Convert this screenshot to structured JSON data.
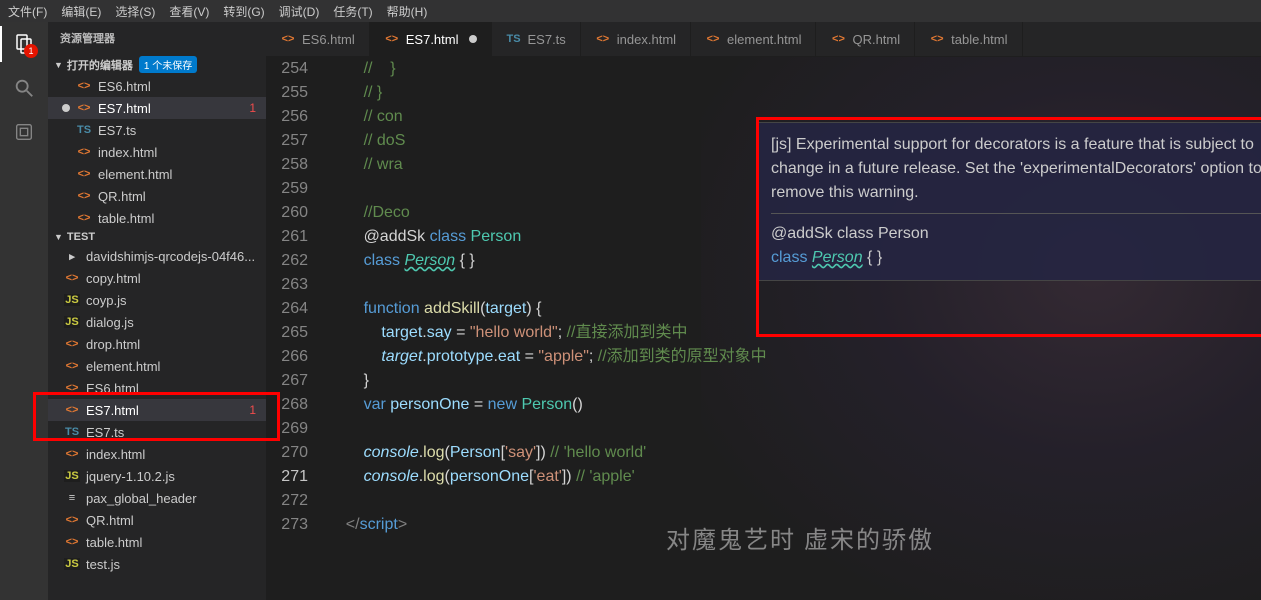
{
  "menu": [
    "文件(F)",
    "编辑(E)",
    "选择(S)",
    "查看(V)",
    "转到(G)",
    "调试(D)",
    "任务(T)",
    "帮助(H)"
  ],
  "activitybar": {
    "explorer_badge": "1"
  },
  "sidebar": {
    "title": "资源管理器",
    "open_editors_label": "打开的编辑器",
    "unsaved_pill": "1 个未保存",
    "open_editors": [
      {
        "icon": "<>",
        "cls": "html",
        "name": "ES6.html"
      },
      {
        "icon": "<>",
        "cls": "html",
        "name": "ES7.html",
        "modified": true,
        "active": true,
        "problems": "1"
      },
      {
        "icon": "TS",
        "cls": "ts",
        "name": "ES7.ts"
      },
      {
        "icon": "<>",
        "cls": "html",
        "name": "index.html"
      },
      {
        "icon": "<>",
        "cls": "html",
        "name": "element.html"
      },
      {
        "icon": "<>",
        "cls": "html",
        "name": "QR.html"
      },
      {
        "icon": "<>",
        "cls": "html",
        "name": "table.html"
      }
    ],
    "folder_label": "TEST",
    "test_items": [
      {
        "icon": "▸",
        "cls": "file",
        "name": "davidshimjs-qrcodejs-04f46...",
        "folder": true
      },
      {
        "icon": "<>",
        "cls": "html",
        "name": "copy.html"
      },
      {
        "icon": "JS",
        "cls": "js",
        "name": "coyp.js"
      },
      {
        "icon": "JS",
        "cls": "js",
        "name": "dialog.js"
      },
      {
        "icon": "<>",
        "cls": "html",
        "name": "drop.html"
      },
      {
        "icon": "<>",
        "cls": "html",
        "name": "element.html"
      },
      {
        "icon": "<>",
        "cls": "html",
        "name": "ES6.html"
      },
      {
        "icon": "<>",
        "cls": "html",
        "name": "ES7.html",
        "active": true,
        "problems": "1"
      },
      {
        "icon": "TS",
        "cls": "ts",
        "name": "ES7.ts"
      },
      {
        "icon": "<>",
        "cls": "html",
        "name": "index.html"
      },
      {
        "icon": "JS",
        "cls": "js",
        "name": "jquery-1.10.2.js"
      },
      {
        "icon": "≡",
        "cls": "file",
        "name": "pax_global_header"
      },
      {
        "icon": "<>",
        "cls": "html",
        "name": "QR.html"
      },
      {
        "icon": "<>",
        "cls": "html",
        "name": "table.html"
      },
      {
        "icon": "JS",
        "cls": "js",
        "name": "test.js"
      }
    ]
  },
  "tabs": [
    {
      "icon": "<>",
      "cls": "html",
      "name": "ES6.html"
    },
    {
      "icon": "<>",
      "cls": "html",
      "name": "ES7.html",
      "active": true,
      "modified": true
    },
    {
      "icon": "TS",
      "cls": "ts",
      "name": "ES7.ts"
    },
    {
      "icon": "<>",
      "cls": "html",
      "name": "index.html"
    },
    {
      "icon": "<>",
      "cls": "html",
      "name": "element.html"
    },
    {
      "icon": "<>",
      "cls": "html",
      "name": "QR.html"
    },
    {
      "icon": "<>",
      "cls": "html",
      "name": "table.html"
    }
  ],
  "line_numbers": [
    "254",
    "255",
    "256",
    "257",
    "258",
    "259",
    "260",
    "261",
    "262",
    "263",
    "264",
    "265",
    "266",
    "267",
    "268",
    "269",
    "270",
    "271",
    "272",
    "273"
  ],
  "active_line": "271",
  "code": {
    "254": [
      [
        "comment",
        "//    }"
      ]
    ],
    "255": [
      [
        "comment",
        "// }"
      ]
    ],
    "256": [
      [
        "comment",
        "// con"
      ]
    ],
    "257": [
      [
        "comment",
        "// doS"
      ]
    ],
    "258": [
      [
        "comment",
        "// wra"
      ]
    ],
    "259": [],
    "260": [
      [
        "comment",
        "//Deco"
      ]
    ],
    "261": [
      [
        "plain",
        "@addSk "
      ],
      [
        "keyword2",
        "class "
      ],
      [
        "type",
        "Person"
      ]
    ],
    "262": [
      [
        "keyword2",
        "class "
      ],
      [
        "underline",
        "Person"
      ],
      [
        "plain",
        " { }"
      ]
    ],
    "263": [],
    "264": [
      [
        "keyword2",
        "function "
      ],
      [
        "func",
        "addSkill"
      ],
      [
        "plain",
        "("
      ],
      [
        "var",
        "target"
      ],
      [
        "plain",
        ") {"
      ]
    ],
    "265": [
      [
        "plain",
        "    "
      ],
      [
        "var",
        "target"
      ],
      [
        "plain",
        "."
      ],
      [
        "var",
        "say"
      ],
      [
        "plain",
        " = "
      ],
      [
        "string",
        "\"hello world\""
      ],
      [
        "plain",
        "; "
      ],
      [
        "comment",
        "//直接添加到类中"
      ]
    ],
    "266": [
      [
        "plain",
        "    "
      ],
      [
        "param",
        "target"
      ],
      [
        "plain",
        "."
      ],
      [
        "var",
        "prototype"
      ],
      [
        "plain",
        "."
      ],
      [
        "var",
        "eat"
      ],
      [
        "plain",
        " = "
      ],
      [
        "string",
        "\"apple\""
      ],
      [
        "plain",
        "; "
      ],
      [
        "comment",
        "//添加到类的原型对象中"
      ]
    ],
    "267": [
      [
        "plain",
        "}"
      ]
    ],
    "268": [
      [
        "keyword2",
        "var "
      ],
      [
        "var",
        "personOne"
      ],
      [
        "plain",
        " = "
      ],
      [
        "keyword2",
        "new "
      ],
      [
        "type",
        "Person"
      ],
      [
        "plain",
        "()"
      ]
    ],
    "269": [],
    "270": [
      [
        "param",
        "console"
      ],
      [
        "plain",
        "."
      ],
      [
        "func",
        "log"
      ],
      [
        "plain",
        "("
      ],
      [
        "var",
        "Person"
      ],
      [
        "plain",
        "["
      ],
      [
        "string",
        "'say'"
      ],
      [
        "plain",
        "]) "
      ],
      [
        "comment",
        "// 'hello world'"
      ]
    ],
    "271": [
      [
        "param",
        "console"
      ],
      [
        "plain",
        "."
      ],
      [
        "func",
        "log"
      ],
      [
        "plain",
        "("
      ],
      [
        "var",
        "personOne"
      ],
      [
        "plain",
        "["
      ],
      [
        "string",
        "'eat'"
      ],
      [
        "plain",
        "]) "
      ],
      [
        "comment",
        "// 'apple'"
      ]
    ],
    "272": [],
    "273": [
      [
        "tag",
        "</"
      ],
      [
        "keyword2",
        "script"
      ],
      [
        "tag",
        ">"
      ]
    ]
  },
  "hover": {
    "msg": "[js] Experimental support for decorators is a feature that is subject to change in a future release. Set the 'experimentalDecorators' option to remove this warning.",
    "sig1": "@addSk class Person",
    "sig2_kw": "class ",
    "sig2_name": "Person",
    "sig2_rest": " { }"
  },
  "watermark": "对魔鬼艺时  虚宋的骄傲"
}
